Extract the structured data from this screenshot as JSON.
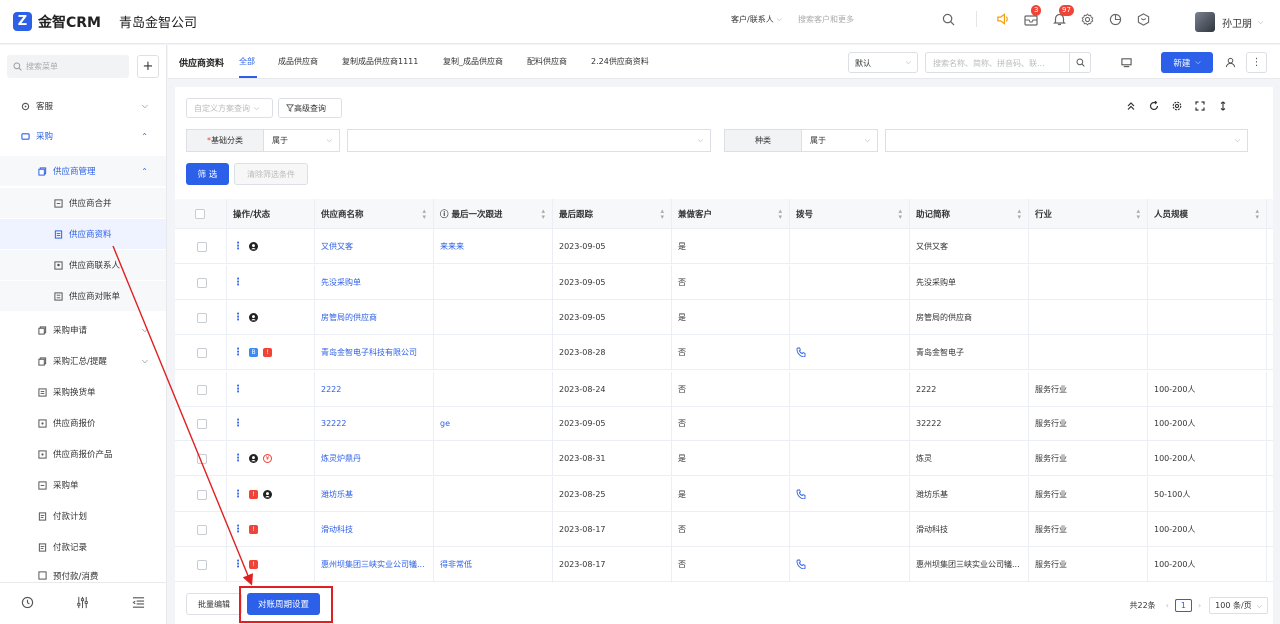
{
  "header": {
    "logo_text": "金智CRM",
    "company": "青岛金智公司",
    "search_scope": "客户/联系人",
    "search_placeholder": "搜索客户和更多",
    "badges": {
      "mail": "3",
      "notice": "97"
    },
    "user_name": "孙卫朋"
  },
  "sidebar": {
    "search_placeholder": "搜索菜单",
    "items": [
      {
        "label": "客服",
        "level": 0
      },
      {
        "label": "采购",
        "level": 0
      },
      {
        "label": "供应商管理",
        "level": 1
      },
      {
        "label": "供应商合并",
        "level": 2
      },
      {
        "label": "供应商资料",
        "level": 2
      },
      {
        "label": "供应商联系人",
        "level": 2
      },
      {
        "label": "供应商对账单",
        "level": 2
      },
      {
        "label": "采购申请",
        "level": 1
      },
      {
        "label": "采购汇总/提醒",
        "level": 1
      },
      {
        "label": "采购换货单",
        "level": 1
      },
      {
        "label": "供应商报价",
        "level": 1
      },
      {
        "label": "供应商报价产品",
        "level": 1
      },
      {
        "label": "采购单",
        "level": 1
      },
      {
        "label": "付款计划",
        "level": 1
      },
      {
        "label": "付款记录",
        "level": 1
      },
      {
        "label": "预付款/消费",
        "level": 1
      }
    ]
  },
  "tabs": {
    "title": "供应商资料",
    "items": [
      "全部",
      "成品供应商",
      "复制成品供应商1111",
      "复制_成品供应商",
      "配料供应商",
      "2.24供应商资料"
    ],
    "view_select": "默认",
    "search_placeholder": "搜索名称、简称、拼音码、联...",
    "new_label": "新建"
  },
  "filters": {
    "custom_plan": "自定义方案查询",
    "advanced": "高级查询",
    "field1_label": "基础分类",
    "field1_op": "属于",
    "field2_label": "种类",
    "field2_op": "属于",
    "filter_btn": "筛 选",
    "clear_btn": "清除筛选条件"
  },
  "table": {
    "columns": [
      "操作/状态",
      "供应商名称",
      "最后一次跟进",
      "最后跟踪",
      "兼做客户",
      "拨号",
      "助记简称",
      "行业",
      "人员规模"
    ],
    "rows": [
      {
        "name": "又供又客",
        "follow": "来来来",
        "last": "2023-09-05",
        "cust": "是",
        "phone": false,
        "abbr": "又供又客",
        "industry": "",
        "size": "",
        "icons": [
          "black"
        ]
      },
      {
        "name": "先没采购单",
        "follow": "",
        "last": "2023-09-05",
        "cust": "否",
        "phone": false,
        "abbr": "先没采购单",
        "industry": "",
        "size": "",
        "icons": []
      },
      {
        "name": "房管局的供应商",
        "follow": "",
        "last": "2023-09-05",
        "cust": "是",
        "phone": false,
        "abbr": "房管局的供应商",
        "industry": "",
        "size": "",
        "icons": [
          "black"
        ]
      },
      {
        "name": "青岛金智电子科技有限公司",
        "follow": "",
        "last": "2023-08-28",
        "cust": "否",
        "phone": true,
        "abbr": "青岛金智电子",
        "industry": "",
        "size": "",
        "icons": [
          "blue",
          "red"
        ]
      },
      {
        "name": "2222",
        "follow": "",
        "last": "2023-08-24",
        "cust": "否",
        "phone": false,
        "abbr": "2222",
        "industry": "服务行业",
        "size": "100-200人",
        "icons": []
      },
      {
        "name": "32222",
        "follow": "ge",
        "last": "2023-09-05",
        "cust": "否",
        "phone": false,
        "abbr": "32222",
        "industry": "服务行业",
        "size": "100-200人",
        "icons": []
      },
      {
        "name": "炼灵炉鼎丹",
        "follow": "",
        "last": "2023-08-31",
        "cust": "是",
        "phone": false,
        "abbr": "炼灵",
        "industry": "服务行业",
        "size": "100-200人",
        "icons": [
          "black",
          "redc"
        ]
      },
      {
        "name": "潍坊乐基",
        "follow": "",
        "last": "2023-08-25",
        "cust": "是",
        "phone": true,
        "abbr": "潍坊乐基",
        "industry": "服务行业",
        "size": "50-100人",
        "icons": [
          "red",
          "black"
        ]
      },
      {
        "name": "滑动科技",
        "follow": "",
        "last": "2023-08-17",
        "cust": "否",
        "phone": false,
        "abbr": "滑动科技",
        "industry": "服务行业",
        "size": "100-200人",
        "icons": [
          "red"
        ]
      },
      {
        "name": "惠州坝集团三峡实业公司犠...",
        "follow": "得非常低",
        "last": "2023-08-17",
        "cust": "否",
        "phone": true,
        "abbr": "惠州坝集团三峡实业公司犠...",
        "industry": "服务行业",
        "size": "100-200人",
        "icons": [
          "red"
        ]
      }
    ]
  },
  "footer": {
    "batch_edit": "批量编辑",
    "period_setting": "对账周期设置",
    "total": "共22条",
    "page": "1",
    "page_size": "100 条/页"
  },
  "colors": {
    "primary": "#2d60e8",
    "annotation": "#e02020"
  }
}
